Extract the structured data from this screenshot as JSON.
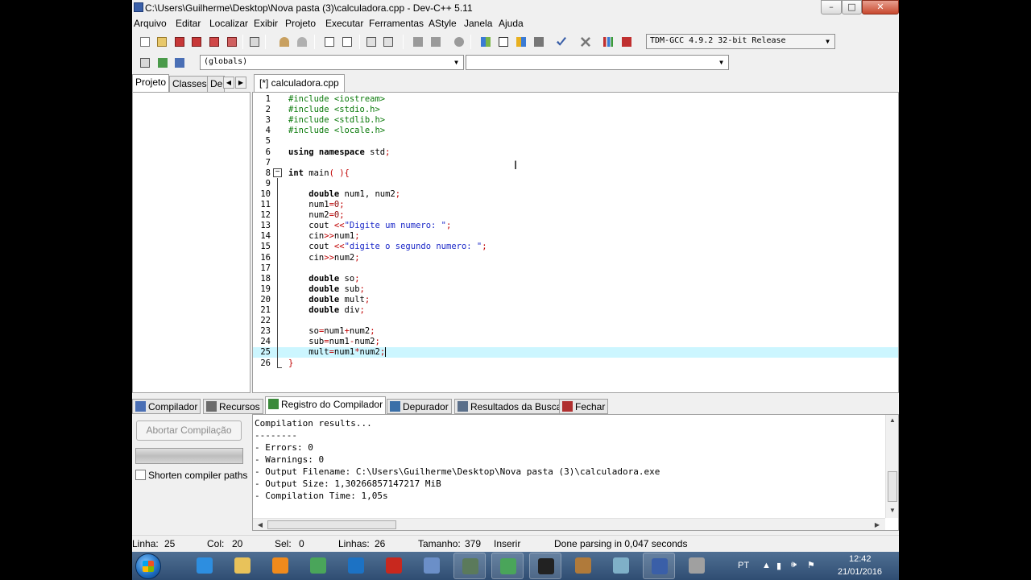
{
  "window": {
    "title": "C:\\Users\\Guilherme\\Desktop\\Nova pasta (3)\\calculadora.cpp - Dev-C++ 5.11",
    "minimize": "–",
    "maximize": "□",
    "close": "✕"
  },
  "menu": [
    "Arquivo",
    "Editar",
    "Localizar",
    "Exibir",
    "Projeto",
    "Executar",
    "Ferramentas",
    "AStyle",
    "Janela",
    "Ajuda"
  ],
  "toolbar": {
    "compiler_select": "TDM-GCC 4.9.2 32-bit Release",
    "globals_select": "(globals)",
    "member_select": ""
  },
  "left_panel": {
    "tabs": [
      "Projeto",
      "Classes",
      "De"
    ]
  },
  "editor": {
    "tab_label": "[*] calculadora.cpp",
    "active_line": 25,
    "lines": [
      {
        "n": "1",
        "html": "<span class=\"c-pre\">#include &lt;iostream&gt;</span>"
      },
      {
        "n": "2",
        "html": "<span class=\"c-pre\">#include &lt;stdio.h&gt;</span>"
      },
      {
        "n": "3",
        "html": "<span class=\"c-pre\">#include &lt;stdlib.h&gt;</span>"
      },
      {
        "n": "4",
        "html": "<span class=\"c-pre\">#include &lt;locale.h&gt;</span>"
      },
      {
        "n": "5",
        "html": ""
      },
      {
        "n": "6",
        "html": "<span class=\"c-kw\">using namespace</span> std<span class=\"c-sym\">;</span>"
      },
      {
        "n": "7",
        "html": ""
      },
      {
        "n": "8",
        "html": "<span class=\"c-kw\">int</span> main<span class=\"c-sym\">( ){</span>"
      },
      {
        "n": "9",
        "html": ""
      },
      {
        "n": "10",
        "html": "    <span class=\"c-kw\">double</span> num1, num2<span class=\"c-sym\">;</span>"
      },
      {
        "n": "11",
        "html": "    num1<span class=\"c-sym\">=</span><span class=\"c-num\">0</span><span class=\"c-sym\">;</span>"
      },
      {
        "n": "12",
        "html": "    num2<span class=\"c-sym\">=</span><span class=\"c-num\">0</span><span class=\"c-sym\">;</span>"
      },
      {
        "n": "13",
        "html": "    cout <span class=\"c-sym\">&lt;&lt;</span><span class=\"c-str\">\"Digite um numero: \"</span><span class=\"c-sym\">;</span>"
      },
      {
        "n": "14",
        "html": "    cin<span class=\"c-sym\">&gt;&gt;</span>num1<span class=\"c-sym\">;</span>"
      },
      {
        "n": "15",
        "html": "    cout <span class=\"c-sym\">&lt;&lt;</span><span class=\"c-str\">\"digite o segundo numero: \"</span><span class=\"c-sym\">;</span>"
      },
      {
        "n": "16",
        "html": "    cin<span class=\"c-sym\">&gt;&gt;</span>num2<span class=\"c-sym\">;</span>"
      },
      {
        "n": "17",
        "html": ""
      },
      {
        "n": "18",
        "html": "    <span class=\"c-kw\">double</span> so<span class=\"c-sym\">;</span>"
      },
      {
        "n": "19",
        "html": "    <span class=\"c-kw\">double</span> sub<span class=\"c-sym\">;</span>"
      },
      {
        "n": "20",
        "html": "    <span class=\"c-kw\">double</span> mult<span class=\"c-sym\">;</span>"
      },
      {
        "n": "21",
        "html": "    <span class=\"c-kw\">double</span> div<span class=\"c-sym\">;</span>"
      },
      {
        "n": "22",
        "html": ""
      },
      {
        "n": "23",
        "html": "    so<span class=\"c-sym\">=</span>num1<span class=\"c-sym\">+</span>num2<span class=\"c-sym\">;</span>"
      },
      {
        "n": "24",
        "html": "    sub<span class=\"c-sym\">=</span>num1<span class=\"c-sym\">-</span>num2<span class=\"c-sym\">;</span>"
      },
      {
        "n": "25",
        "html": "    mult<span class=\"c-sym\">=</span>num1<span class=\"c-sym\">*</span>num2<span class=\"c-sym\">;</span>"
      },
      {
        "n": "26",
        "html": "<span class=\"c-sym\">}</span>"
      }
    ]
  },
  "bottom_tabs": [
    {
      "label": "Compilador",
      "icon": "compiler-grid-icon",
      "color": "#4a6fb5"
    },
    {
      "label": "Recursos",
      "icon": "resources-icon",
      "color": "#6b6b6b"
    },
    {
      "label": "Registro do Compilador",
      "icon": "compile-log-icon",
      "color": "#3b8a3b"
    },
    {
      "label": "Depurador",
      "icon": "debugger-check-icon",
      "color": "#3a6fa8"
    },
    {
      "label": "Resultados da Busca",
      "icon": "search-results-icon",
      "color": "#5a6f8a"
    },
    {
      "label": "Fechar",
      "icon": "close-panel-icon",
      "color": "#b03030"
    }
  ],
  "compile_panel": {
    "abort_label": "Abortar Compilação",
    "shorten_label": "Shorten compiler paths",
    "log": [
      "Compilation results...",
      "--------",
      "- Errors: 0",
      "- Warnings: 0",
      "- Output Filename: C:\\Users\\Guilherme\\Desktop\\Nova pasta (3)\\calculadora.exe",
      "- Output Size: 1,30266857147217 MiB",
      "- Compilation Time: 1,05s"
    ]
  },
  "status": {
    "linha_label": "Linha:",
    "linha": "25",
    "col_label": "Col:",
    "col": "20",
    "sel_label": "Sel:",
    "sel": "0",
    "linhas_label": "Linhas:",
    "linhas": "26",
    "tamanho_label": "Tamanho:",
    "tamanho": "379",
    "mode": "Inserir",
    "message": "Done parsing in 0,047 seconds"
  },
  "taskbar": {
    "lang": "PT",
    "time": "12:42",
    "date": "21/01/2016",
    "apps": [
      {
        "name": "internet-explorer-icon",
        "color": "#2d8ee0",
        "running": false
      },
      {
        "name": "file-explorer-icon",
        "color": "#e8c25a",
        "running": false
      },
      {
        "name": "media-player-icon",
        "color": "#f08a1c",
        "running": false
      },
      {
        "name": "chrome-icon",
        "color": "#4aa55a",
        "running": false
      },
      {
        "name": "refresh-app-icon",
        "color": "#1c72c4",
        "running": false
      },
      {
        "name": "game-app-icon",
        "color": "#c8281e",
        "running": false
      },
      {
        "name": "virtualbox-icon",
        "color": "#6b8fc8",
        "running": false
      },
      {
        "name": "terminal-app-icon",
        "color": "#5b7a5b",
        "running": true
      },
      {
        "name": "chrome-window-icon",
        "color": "#4aa55a",
        "running": true
      },
      {
        "name": "command-prompt-icon",
        "color": "#222222",
        "running": true
      },
      {
        "name": "gimp-icon",
        "color": "#b07a3a",
        "running": false
      },
      {
        "name": "notepad-icon",
        "color": "#7fb0c8",
        "running": false
      },
      {
        "name": "devcpp-icon",
        "color": "#3a5fa8",
        "running": true
      },
      {
        "name": "recycle-bin-icon",
        "color": "#a0a0a0",
        "running": false
      }
    ]
  }
}
